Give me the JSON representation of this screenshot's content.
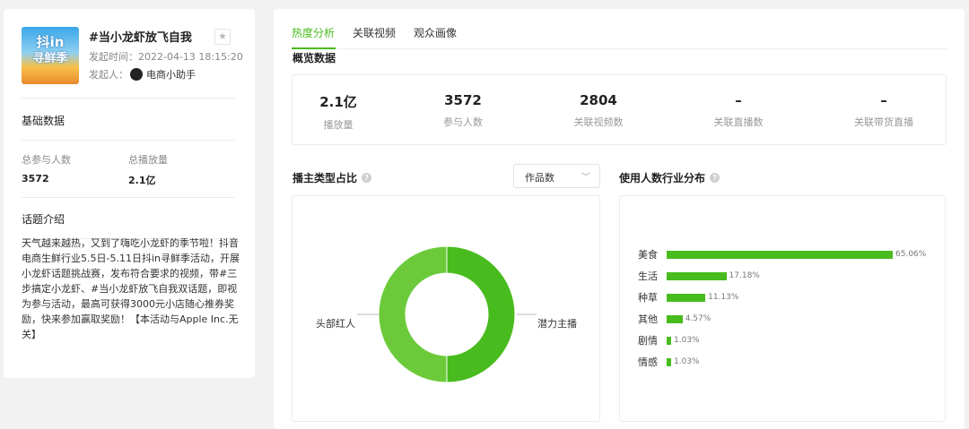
{
  "topic": {
    "thumb_line1": "抖in",
    "thumb_line2": "寻鲜季",
    "title": "#当小龙虾放飞自我",
    "created": "发起时间：2022-04-13 18:15:20",
    "initiator_label": "发起人：",
    "initiator_name": "电商小助手"
  },
  "basic": {
    "section_title": "基础数据",
    "participants_label": "总参与人数",
    "participants_value": "3572",
    "plays_label": "总播放量",
    "plays_value": "2.1亿"
  },
  "intro": {
    "section_title": "话题介绍",
    "text": "天气越来越热，又到了嗨吃小龙虾的季节啦！抖音电商生鲜行业5.5日-5.11日抖in寻鲜季活动，开展小龙虾话题挑战赛，发布符合要求的视频，带#三步搞定小龙虾、#当小龙虾放飞自我双话题，即视为参与活动，最高可获得3000元小店随心推券奖励，快来参加赢取奖励！【本活动与Apple Inc.无关】"
  },
  "tabs": [
    "热度分析",
    "关联视频",
    "观众画像"
  ],
  "overview": {
    "title": "概览数据",
    "cells": [
      {
        "value": "2.1亿",
        "label": "播放量"
      },
      {
        "value": "3572",
        "label": "参与人数"
      },
      {
        "value": "2804",
        "label": "关联视频数"
      },
      {
        "value": "–",
        "label": "关联直播数"
      },
      {
        "value": "–",
        "label": "关联带货直播"
      }
    ]
  },
  "donut": {
    "title": "播主类型占比",
    "select_value": "作品数",
    "colors": [
      "#48bb1e",
      "#6cca3a"
    ]
  },
  "industry": {
    "title": "使用人数行业分布",
    "bar_color": "#48bb1e"
  },
  "chart_data": [
    {
      "type": "pie",
      "title": "播主类型占比",
      "categories": [
        "潜力主播",
        "头部红人"
      ],
      "values": [
        50,
        50
      ]
    },
    {
      "type": "bar",
      "title": "使用人数行业分布",
      "categories": [
        "美食",
        "生活",
        "种草",
        "其他",
        "剧情",
        "情感"
      ],
      "values": [
        65.06,
        17.18,
        11.13,
        4.57,
        1.03,
        1.03
      ],
      "labels": [
        "65.06%",
        "17.18%",
        "11.13%",
        "4.57%",
        "1.03%",
        "1.03%"
      ],
      "orientation": "horizontal"
    }
  ]
}
